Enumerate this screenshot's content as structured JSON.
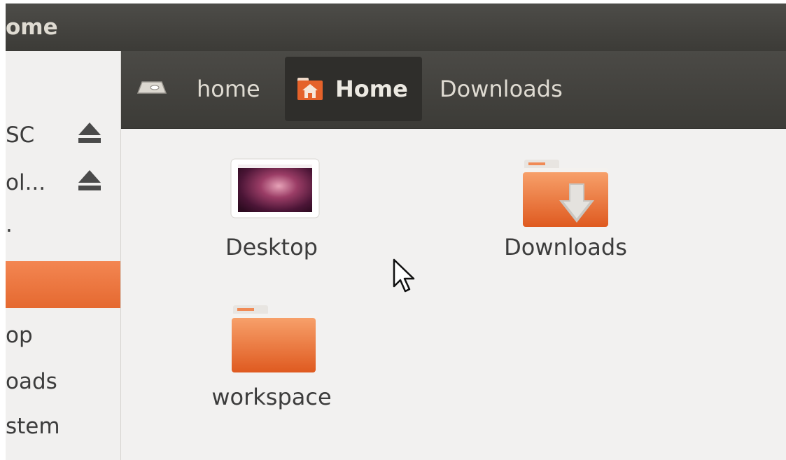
{
  "window": {
    "title": "ome"
  },
  "sidebar": {
    "items": [
      {
        "label": "SC",
        "eject": true
      },
      {
        "label": "ol...",
        "eject": true
      },
      {
        "label": ".",
        "eject": false
      },
      {
        "label": "",
        "active": true
      },
      {
        "label": "op",
        "eject": false
      },
      {
        "label": "oads",
        "eject": false
      },
      {
        "label": "stem",
        "eject": false
      }
    ]
  },
  "pathbar": {
    "crumbs": [
      {
        "label": "home",
        "icon": "drive-icon"
      },
      {
        "label": "Home",
        "icon": "home-folder-icon",
        "active": true
      },
      {
        "label": "Downloads"
      }
    ]
  },
  "files": [
    {
      "label": "Desktop",
      "icon": "desktop-folder-icon"
    },
    {
      "label": "Downloads",
      "icon": "downloads-folder-icon"
    },
    {
      "label": "workspace",
      "icon": "folder-icon"
    }
  ],
  "colors": {
    "accent": "#e95420",
    "titlebar": "#3c3b37",
    "folder": "#ea6b2c"
  }
}
